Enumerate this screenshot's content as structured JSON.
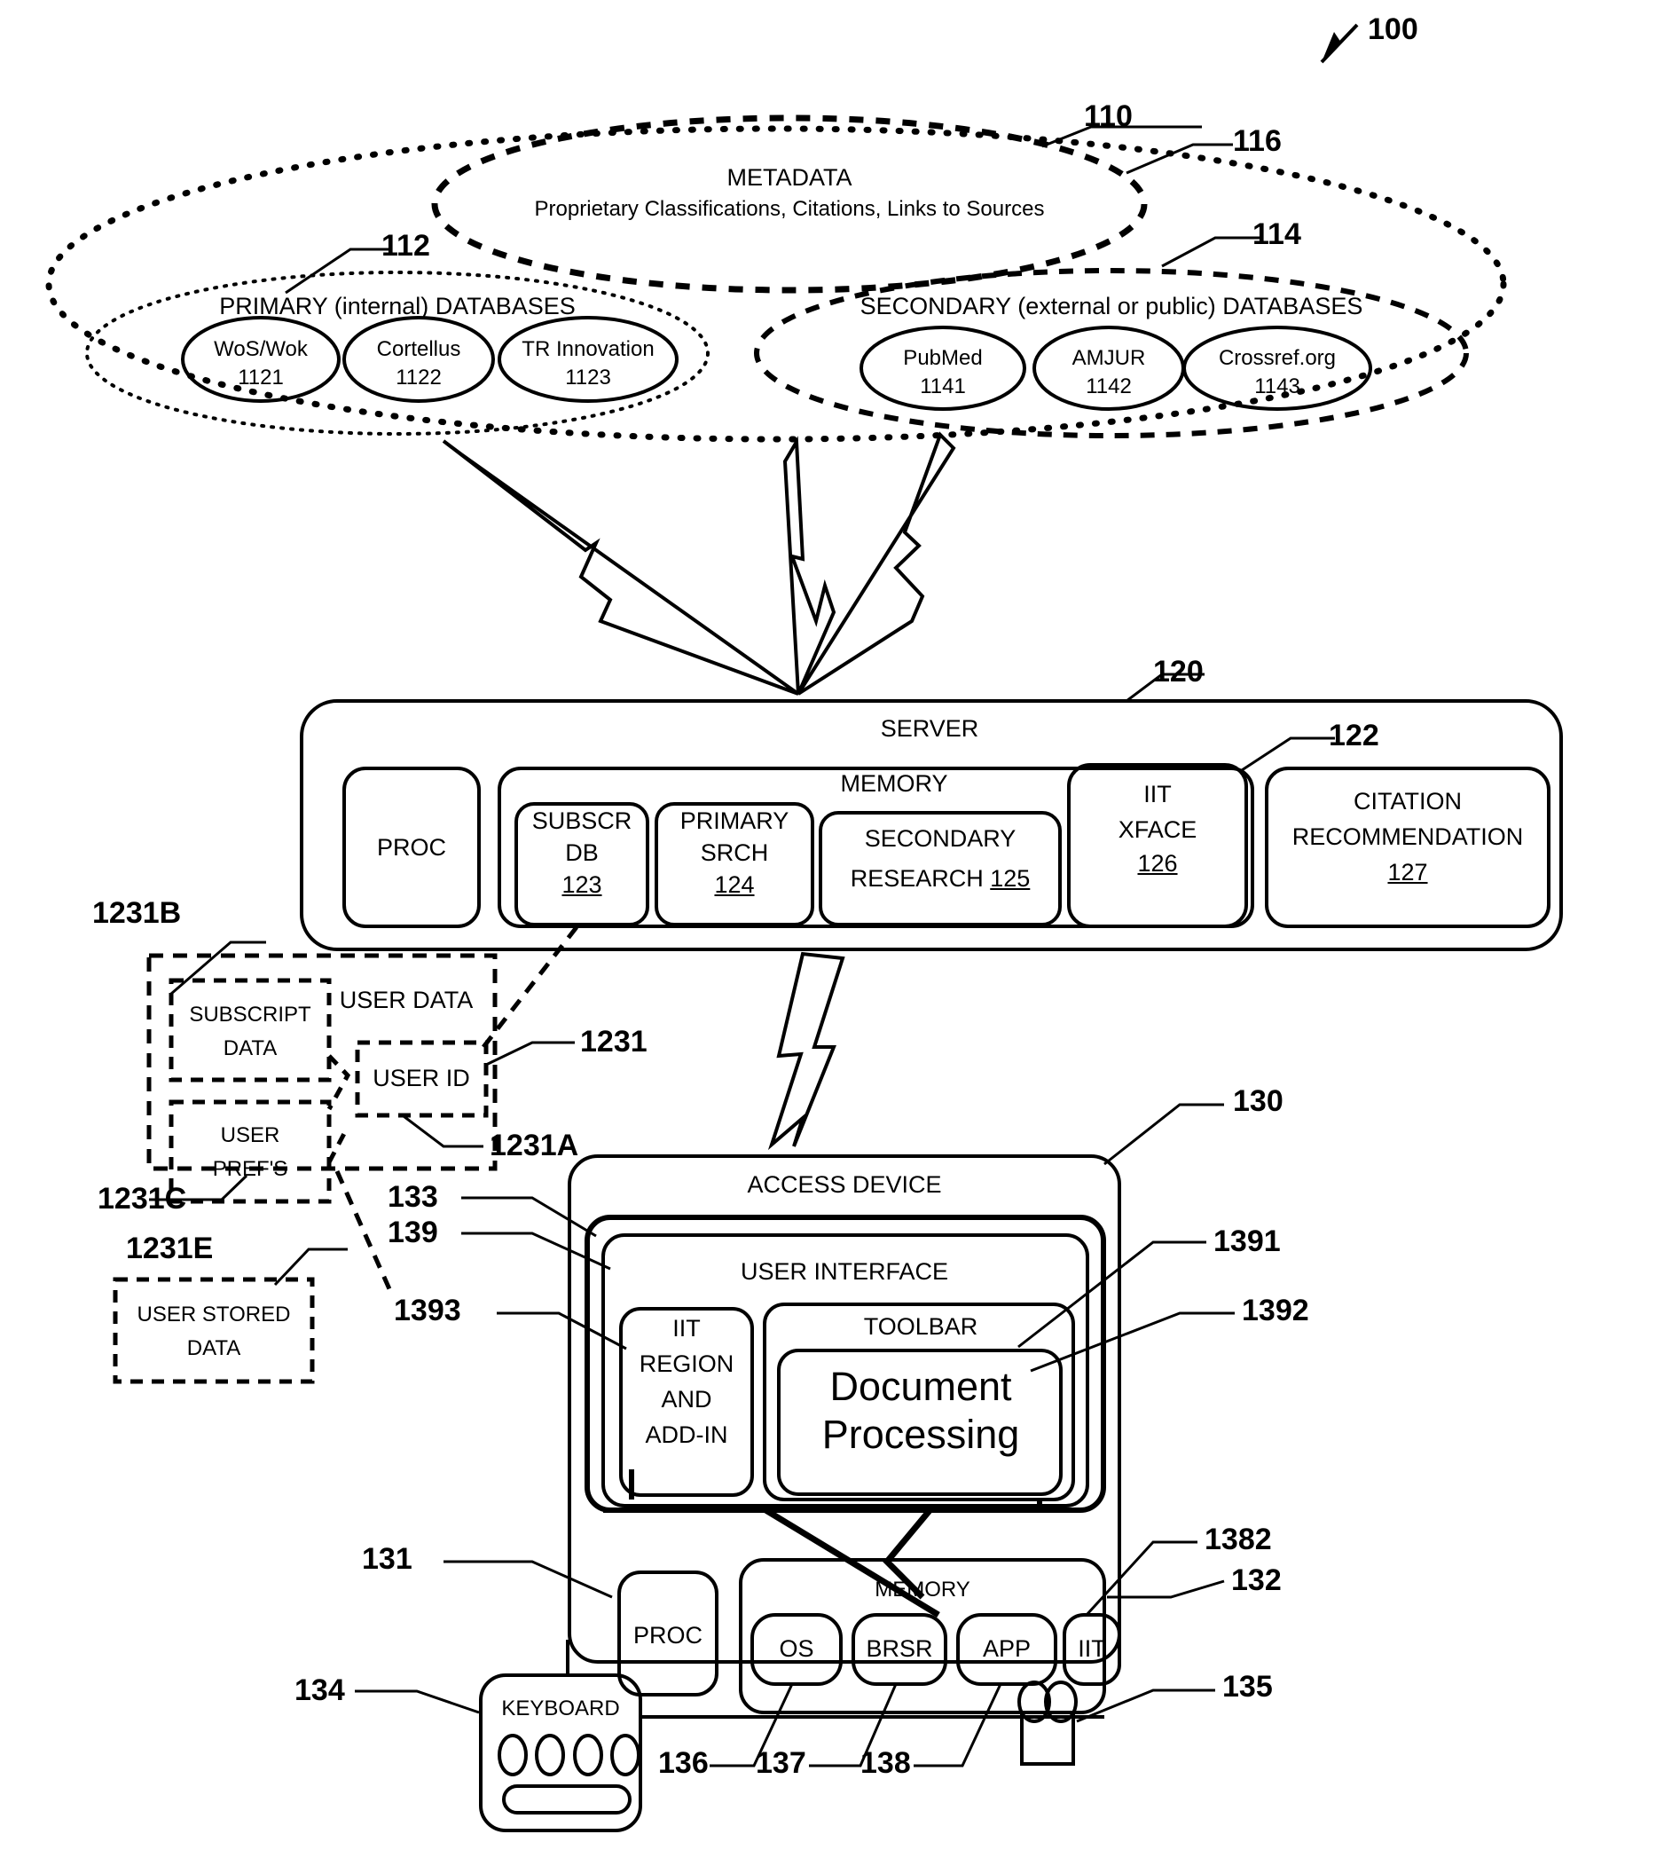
{
  "figure": {
    "ref_main": "100",
    "cloud": {
      "ref": "110",
      "metadata": {
        "ref": "116",
        "title": "METADATA",
        "subtitle": "Proprietary Classifications, Citations, Links to Sources"
      },
      "primary": {
        "ref": "112",
        "title": "PRIMARY (internal) DATABASES",
        "items": [
          {
            "name": "WoS/Wok",
            "num": "1121"
          },
          {
            "name": "Cortellus",
            "num": "1122"
          },
          {
            "name": "TR Innovation",
            "num": "1123"
          }
        ]
      },
      "secondary": {
        "ref": "114",
        "title": "SECONDARY (external or public) DATABASES",
        "items": [
          {
            "name": "PubMed",
            "num": "1141"
          },
          {
            "name": "AMJUR",
            "num": "1142"
          },
          {
            "name": "Crossref.org",
            "num": "1143"
          }
        ]
      }
    },
    "server": {
      "ref": "120",
      "title": "SERVER",
      "proc_label": "PROC",
      "memory": {
        "ref": "122",
        "title": "MEMORY",
        "modules": [
          {
            "line1": "SUBSCR",
            "line2": "DB",
            "num": "123"
          },
          {
            "line1": "PRIMARY",
            "line2": "SRCH",
            "num": "124"
          },
          {
            "line1": "SECONDARY",
            "line2": "RESEARCH",
            "num": "125"
          },
          {
            "line1": "IIT",
            "line2": "XFACE",
            "num": "126"
          }
        ]
      },
      "citation_rec": {
        "line1": "CITATION",
        "line2": "RECOMMENDATION",
        "num": "127"
      }
    },
    "user_data": {
      "ref": "1231",
      "title": "USER DATA",
      "subscript_data": {
        "ref": "1231B",
        "line1": "SUBSCRIPT",
        "line2": "DATA"
      },
      "user_prefs": {
        "ref": "1231C",
        "line1": "USER",
        "line2": "PREF'S"
      },
      "user_id": {
        "ref": "1231A",
        "label": "USER ID"
      },
      "user_stored": {
        "ref": "1231E",
        "line1": "USER STORED",
        "line2": "DATA"
      }
    },
    "access_device": {
      "ref": "130",
      "title": "ACCESS DEVICE",
      "display_ref": "133",
      "ui": {
        "ref": "139",
        "title": "USER INTERFACE",
        "iit_region": {
          "ref": "1393",
          "line1": "IIT",
          "line2": "REGION",
          "line3": "AND",
          "line4": "ADD-IN"
        },
        "toolbar": {
          "ref": "1391",
          "label": "TOOLBAR"
        },
        "document_processing": {
          "ref": "1392",
          "line1": "Document",
          "line2": "Processing"
        }
      },
      "proc": {
        "ref": "131",
        "label": "PROC"
      },
      "memory": {
        "ref": "132",
        "title": "MEMORY",
        "modules": [
          {
            "label": "OS",
            "ref": "136"
          },
          {
            "label": "BRSR",
            "ref": "137"
          },
          {
            "label": "APP",
            "ref": "138"
          },
          {
            "label": "IIT",
            "ref": "1382"
          }
        ]
      },
      "keyboard": {
        "ref": "134",
        "label": "KEYBOARD"
      },
      "mouse": {
        "ref": "135"
      }
    }
  }
}
